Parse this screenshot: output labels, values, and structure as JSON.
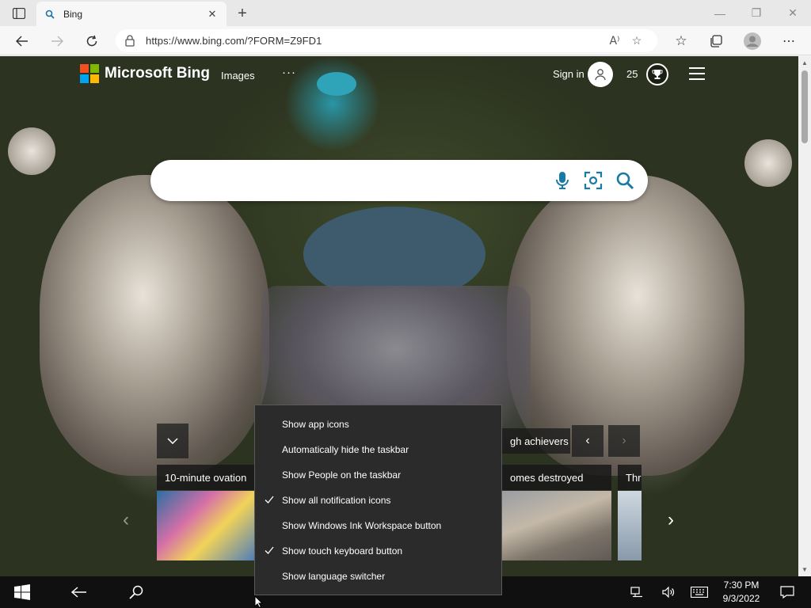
{
  "browser": {
    "tab": {
      "title": "Bing"
    },
    "address_bar": {
      "url": "https://www.bing.com/?FORM=Z9FD1"
    }
  },
  "bing": {
    "brand": "Microsoft Bing",
    "nav": {
      "images": "Images",
      "more": "···"
    },
    "account": {
      "sign_in": "Sign in",
      "points": "25"
    },
    "logo_colors": [
      "#f25022",
      "#7fba00",
      "#00a4ef",
      "#ffb900"
    ],
    "accent_color": "#1a7aa6",
    "search": {
      "value": ""
    },
    "carousel": {
      "cards": [
        {
          "label": "10-minute ovation"
        },
        {
          "label": "gh achievers"
        },
        {
          "label": "omes destroyed"
        },
        {
          "label": "Thr"
        }
      ]
    }
  },
  "context_menu": {
    "items": [
      {
        "label": "Show app icons",
        "checked": false
      },
      {
        "label": "Automatically hide the taskbar",
        "checked": false
      },
      {
        "label": "Show People on the taskbar",
        "checked": false
      },
      {
        "label": "Show all notification icons",
        "checked": true
      },
      {
        "label": "Show Windows Ink Workspace button",
        "checked": false
      },
      {
        "label": "Show touch keyboard button",
        "checked": true
      },
      {
        "label": "Show language switcher",
        "checked": false
      }
    ]
  },
  "taskbar": {
    "time": "7:30 PM",
    "date": "9/3/2022"
  }
}
